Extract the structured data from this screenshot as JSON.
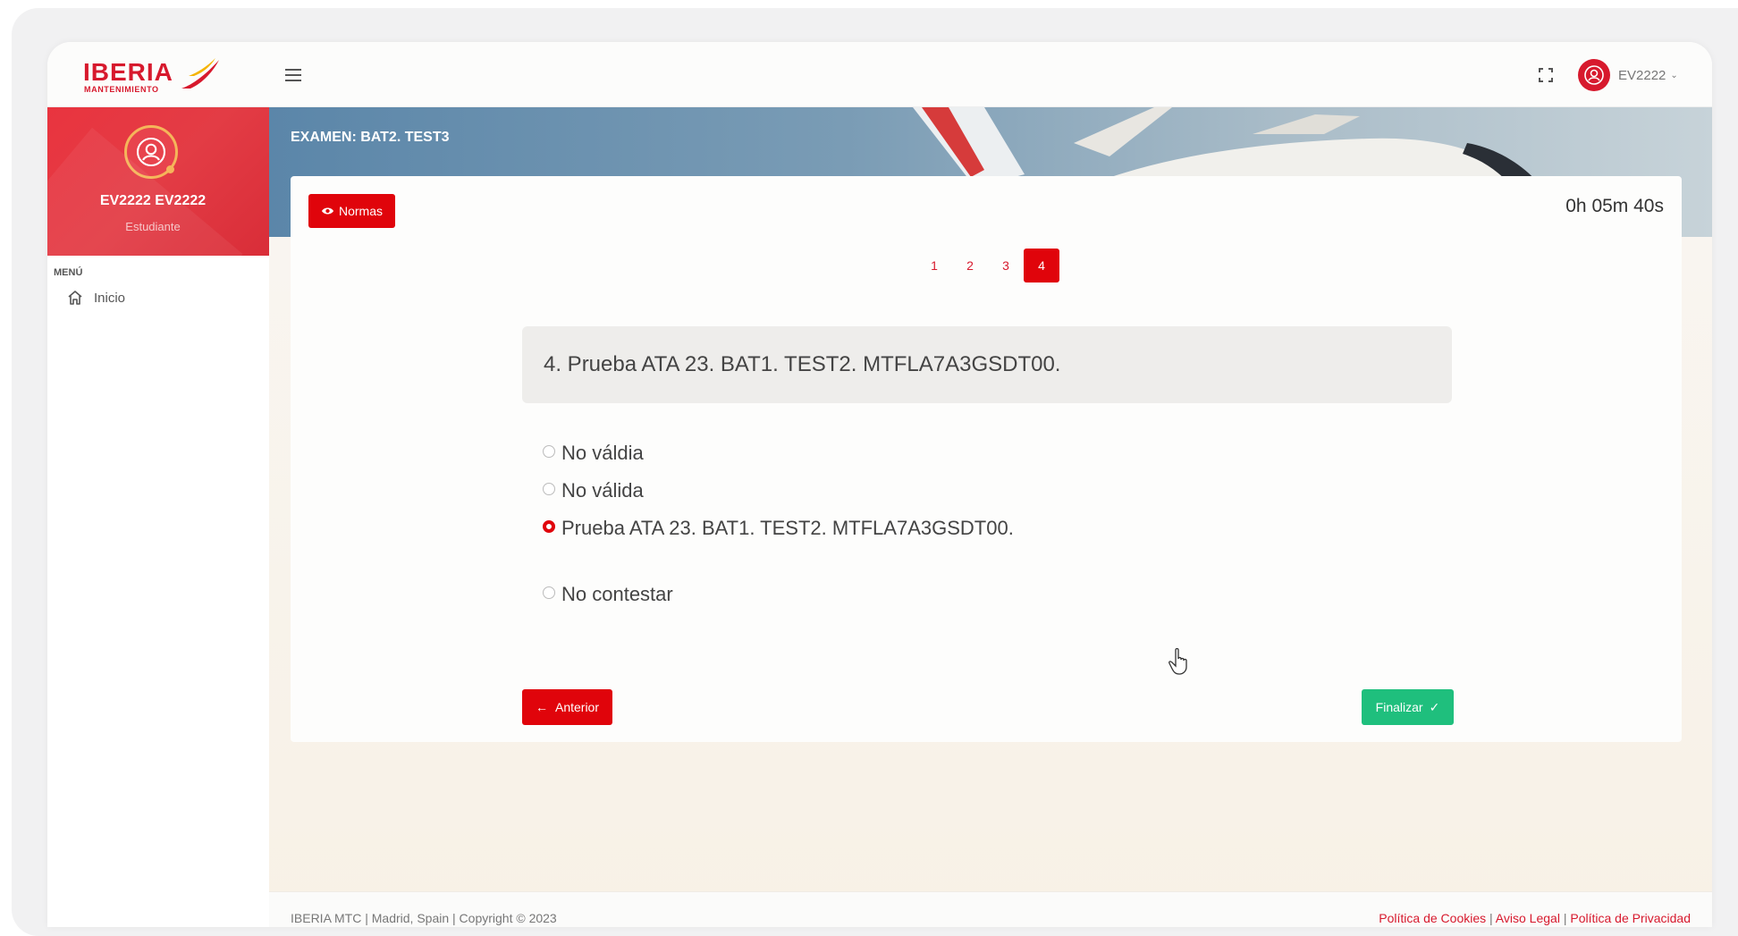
{
  "brand": {
    "name": "IBERIA",
    "subtitle": "MANTENIMIENTO"
  },
  "header": {
    "user_name": "EV2222",
    "caret": "⌄"
  },
  "sidebar": {
    "profile_name": "EV2222 EV2222",
    "profile_role": "Estudiante",
    "menu_heading": "MENÚ",
    "items": [
      {
        "label": "Inicio",
        "icon": "home-icon"
      }
    ]
  },
  "exam": {
    "title": "EXAMEN: BAT2. TEST3",
    "rules_label": "Normas",
    "timer": "0h 05m 40s",
    "pages": [
      "1",
      "2",
      "3",
      "4"
    ],
    "active_page": "4",
    "question": "4. Prueba ATA 23. BAT1. TEST2. MTFLA7A3GSDT00.",
    "options": [
      {
        "label": "No váldia",
        "checked": false
      },
      {
        "label": "No válida",
        "checked": false
      },
      {
        "label": "Prueba ATA 23. BAT1. TEST2. MTFLA7A3GSDT00.",
        "checked": true
      },
      {
        "label": "No contestar",
        "checked": false
      }
    ],
    "prev_label": "Anterior",
    "finish_label": "Finalizar"
  },
  "footer": {
    "copyright": "IBERIA MTC | Madrid, Spain | Copyright © 2023",
    "links": [
      "Política de Cookies",
      "Aviso Legal",
      "Política de Privacidad"
    ],
    "separator": "|"
  },
  "colors": {
    "brand_red": "#e0040b",
    "success_green": "#1fbf7d",
    "sidebar_red": "#e33c45"
  }
}
